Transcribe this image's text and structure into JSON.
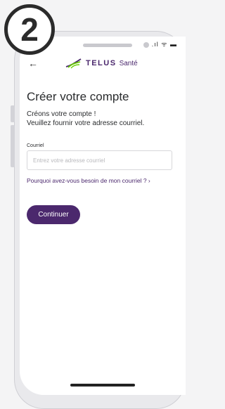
{
  "step_badge": "2",
  "status_bar": {
    "icons": ".ıl ᯤ ▬"
  },
  "header": {
    "back_glyph": "←",
    "brand_name": "TELUS",
    "brand_suffix": "Santé",
    "brand_color": "#4b286d",
    "accent_color": "#66cc00"
  },
  "main": {
    "title": "Créer votre compte",
    "intro_line1": "Créons votre compte !",
    "intro_line2": "Veuillez fournir votre adresse courriel.",
    "email_label": "Courriel",
    "email_placeholder": "Entrez votre adresse courriel",
    "email_value": "",
    "why_link": "Pourquoi avez-vous besoin de mon courriel ?  ›",
    "continue_label": "Continuer"
  }
}
